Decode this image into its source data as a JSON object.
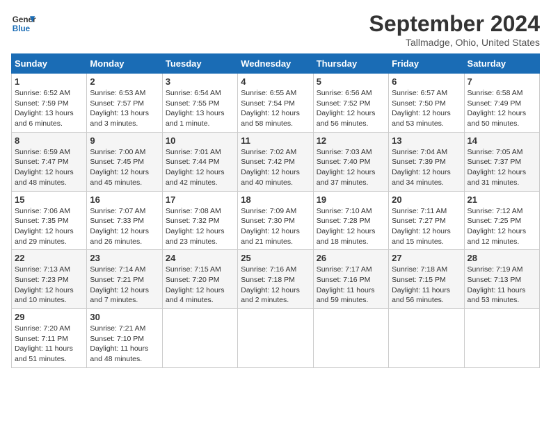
{
  "header": {
    "logo_line1": "General",
    "logo_line2": "Blue",
    "month_title": "September 2024",
    "location": "Tallmadge, Ohio, United States"
  },
  "days_of_week": [
    "Sunday",
    "Monday",
    "Tuesday",
    "Wednesday",
    "Thursday",
    "Friday",
    "Saturday"
  ],
  "weeks": [
    [
      {
        "num": "1",
        "sunrise": "6:52 AM",
        "sunset": "7:59 PM",
        "daylight": "13 hours and 6 minutes."
      },
      {
        "num": "2",
        "sunrise": "6:53 AM",
        "sunset": "7:57 PM",
        "daylight": "13 hours and 3 minutes."
      },
      {
        "num": "3",
        "sunrise": "6:54 AM",
        "sunset": "7:55 PM",
        "daylight": "13 hours and 1 minute."
      },
      {
        "num": "4",
        "sunrise": "6:55 AM",
        "sunset": "7:54 PM",
        "daylight": "12 hours and 58 minutes."
      },
      {
        "num": "5",
        "sunrise": "6:56 AM",
        "sunset": "7:52 PM",
        "daylight": "12 hours and 56 minutes."
      },
      {
        "num": "6",
        "sunrise": "6:57 AM",
        "sunset": "7:50 PM",
        "daylight": "12 hours and 53 minutes."
      },
      {
        "num": "7",
        "sunrise": "6:58 AM",
        "sunset": "7:49 PM",
        "daylight": "12 hours and 50 minutes."
      }
    ],
    [
      {
        "num": "8",
        "sunrise": "6:59 AM",
        "sunset": "7:47 PM",
        "daylight": "12 hours and 48 minutes."
      },
      {
        "num": "9",
        "sunrise": "7:00 AM",
        "sunset": "7:45 PM",
        "daylight": "12 hours and 45 minutes."
      },
      {
        "num": "10",
        "sunrise": "7:01 AM",
        "sunset": "7:44 PM",
        "daylight": "12 hours and 42 minutes."
      },
      {
        "num": "11",
        "sunrise": "7:02 AM",
        "sunset": "7:42 PM",
        "daylight": "12 hours and 40 minutes."
      },
      {
        "num": "12",
        "sunrise": "7:03 AM",
        "sunset": "7:40 PM",
        "daylight": "12 hours and 37 minutes."
      },
      {
        "num": "13",
        "sunrise": "7:04 AM",
        "sunset": "7:39 PM",
        "daylight": "12 hours and 34 minutes."
      },
      {
        "num": "14",
        "sunrise": "7:05 AM",
        "sunset": "7:37 PM",
        "daylight": "12 hours and 31 minutes."
      }
    ],
    [
      {
        "num": "15",
        "sunrise": "7:06 AM",
        "sunset": "7:35 PM",
        "daylight": "12 hours and 29 minutes."
      },
      {
        "num": "16",
        "sunrise": "7:07 AM",
        "sunset": "7:33 PM",
        "daylight": "12 hours and 26 minutes."
      },
      {
        "num": "17",
        "sunrise": "7:08 AM",
        "sunset": "7:32 PM",
        "daylight": "12 hours and 23 minutes."
      },
      {
        "num": "18",
        "sunrise": "7:09 AM",
        "sunset": "7:30 PM",
        "daylight": "12 hours and 21 minutes."
      },
      {
        "num": "19",
        "sunrise": "7:10 AM",
        "sunset": "7:28 PM",
        "daylight": "12 hours and 18 minutes."
      },
      {
        "num": "20",
        "sunrise": "7:11 AM",
        "sunset": "7:27 PM",
        "daylight": "12 hours and 15 minutes."
      },
      {
        "num": "21",
        "sunrise": "7:12 AM",
        "sunset": "7:25 PM",
        "daylight": "12 hours and 12 minutes."
      }
    ],
    [
      {
        "num": "22",
        "sunrise": "7:13 AM",
        "sunset": "7:23 PM",
        "daylight": "12 hours and 10 minutes."
      },
      {
        "num": "23",
        "sunrise": "7:14 AM",
        "sunset": "7:21 PM",
        "daylight": "12 hours and 7 minutes."
      },
      {
        "num": "24",
        "sunrise": "7:15 AM",
        "sunset": "7:20 PM",
        "daylight": "12 hours and 4 minutes."
      },
      {
        "num": "25",
        "sunrise": "7:16 AM",
        "sunset": "7:18 PM",
        "daylight": "12 hours and 2 minutes."
      },
      {
        "num": "26",
        "sunrise": "7:17 AM",
        "sunset": "7:16 PM",
        "daylight": "11 hours and 59 minutes."
      },
      {
        "num": "27",
        "sunrise": "7:18 AM",
        "sunset": "7:15 PM",
        "daylight": "11 hours and 56 minutes."
      },
      {
        "num": "28",
        "sunrise": "7:19 AM",
        "sunset": "7:13 PM",
        "daylight": "11 hours and 53 minutes."
      }
    ],
    [
      {
        "num": "29",
        "sunrise": "7:20 AM",
        "sunset": "7:11 PM",
        "daylight": "11 hours and 51 minutes."
      },
      {
        "num": "30",
        "sunrise": "7:21 AM",
        "sunset": "7:10 PM",
        "daylight": "11 hours and 48 minutes."
      },
      null,
      null,
      null,
      null,
      null
    ]
  ]
}
